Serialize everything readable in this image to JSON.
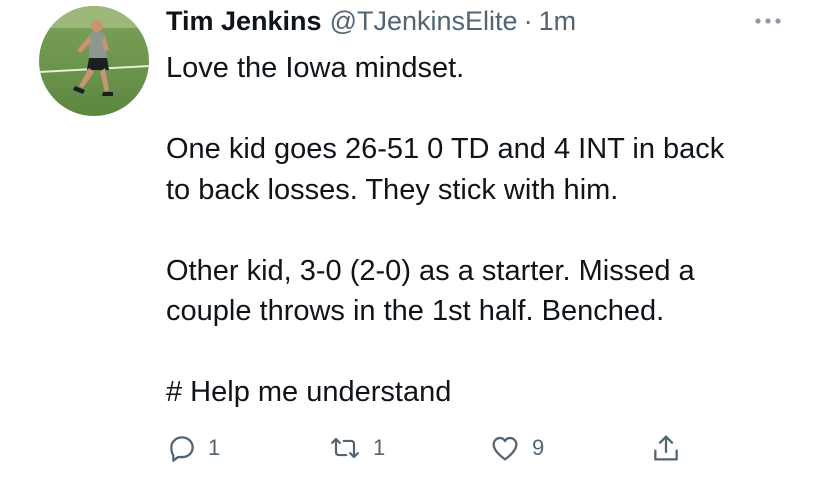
{
  "tweet": {
    "author": {
      "display_name": "Tim Jenkins",
      "handle": "@TJenkinsElite",
      "separator": "·",
      "time": "1m"
    },
    "text": {
      "line1": "Love the Iowa mindset.",
      "para2": [
        "One kid goes 26-51 0 TD and 4 INT in back",
        "to back losses. They stick with him."
      ],
      "para3": [
        "Other kid, 3-0 (2-0) as a starter. Missed a",
        "couple throws in the 1st half. Benched."
      ],
      "line4": "# Help me understand"
    },
    "actions": {
      "reply_count": "1",
      "retweet_count": "1",
      "like_count": "9"
    },
    "icons": {
      "more": "more-horizontal-icon",
      "reply": "reply-icon",
      "retweet": "retweet-icon",
      "like": "heart-icon",
      "share": "share-icon"
    },
    "colors": {
      "text": "#0f1419",
      "secondary": "#536471"
    }
  }
}
